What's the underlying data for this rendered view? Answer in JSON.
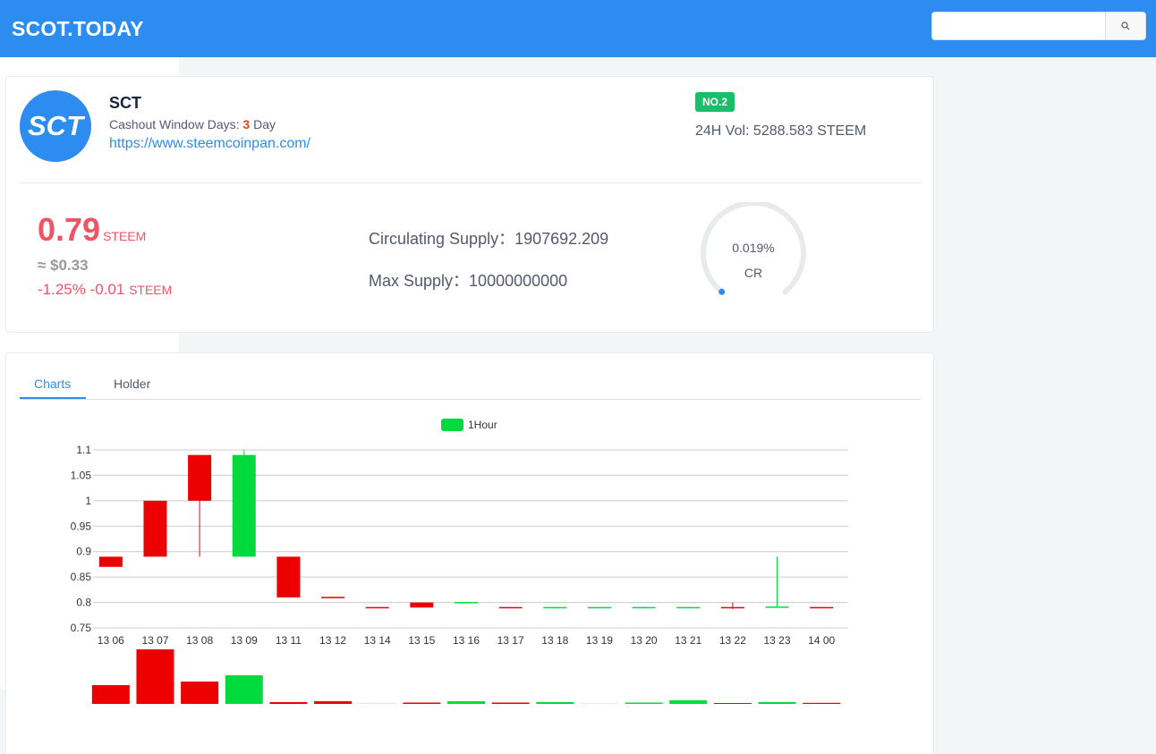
{
  "header": {
    "brand": "SCOT.TODAY",
    "search": {
      "placeholder": "",
      "value": ""
    }
  },
  "token": {
    "logo_text": "SCT",
    "name": "SCT",
    "cashout_label": "Cashout Window Days:",
    "cashout_days": "3",
    "cashout_unit": "Day",
    "website": "https://www.steemcoinpan.com/",
    "rank": "NO.2",
    "volume": "24H Vol: 5288.583 STEEM",
    "price": "0.79",
    "price_unit": "STEEM",
    "usd": "≈ $0.33",
    "change": "-1.25% -0.01",
    "change_unit": "STEEM",
    "circulating": "Circulating Supply：1907692.209",
    "max_supply": "Max Supply：10000000000",
    "cr_percent": "0.019%",
    "cr_label": "CR",
    "cr_value": 0.019
  },
  "tabs": {
    "charts": "Charts",
    "holder": "Holder"
  },
  "colors": {
    "up": "#00da3c",
    "down": "#ec0000",
    "accent": "#2d8cf0"
  },
  "chart_data": {
    "type": "candlestick",
    "legend": [
      "1Hour"
    ],
    "ylim": [
      0.75,
      1.1
    ],
    "yticks": [
      "0.75",
      "0.8",
      "0.85",
      "0.9",
      "0.95",
      "1",
      "1.05",
      "1.1"
    ],
    "categories": [
      "13 06",
      "13 07",
      "13 08",
      "13 09",
      "13 11",
      "13 12",
      "13 14",
      "13 15",
      "13 16",
      "13 17",
      "13 18",
      "13 19",
      "13 20",
      "13 21",
      "13 22",
      "13 23",
      "14 00"
    ],
    "ohlc": [
      [
        0.89,
        0.87,
        0.87,
        0.89
      ],
      [
        1.0,
        0.89,
        0.89,
        1.0
      ],
      [
        1.09,
        1.0,
        0.89,
        1.09
      ],
      [
        0.89,
        1.09,
        0.89,
        1.1
      ],
      [
        0.89,
        0.81,
        0.81,
        0.89
      ],
      [
        0.811,
        0.809,
        0.809,
        0.811
      ],
      [
        0.791,
        0.789,
        0.789,
        0.791
      ],
      [
        0.8,
        0.79,
        0.79,
        0.8
      ],
      [
        0.8,
        0.801,
        0.8,
        0.801
      ],
      [
        0.791,
        0.789,
        0.789,
        0.791
      ],
      [
        0.79,
        0.791,
        0.79,
        0.791
      ],
      [
        0.79,
        0.791,
        0.79,
        0.791
      ],
      [
        0.79,
        0.791,
        0.79,
        0.791
      ],
      [
        0.79,
        0.791,
        0.79,
        0.791
      ],
      [
        0.791,
        0.789,
        0.787,
        0.8
      ],
      [
        0.79,
        0.792,
        0.79,
        0.89
      ],
      [
        0.791,
        0.789,
        0.789,
        0.791
      ]
    ],
    "volumes": [
      21,
      61,
      25,
      32,
      2,
      3,
      0.3,
      1.5,
      3,
      1.5,
      2,
      0.3,
      1.5,
      4,
      1,
      2,
      1.2
    ]
  }
}
